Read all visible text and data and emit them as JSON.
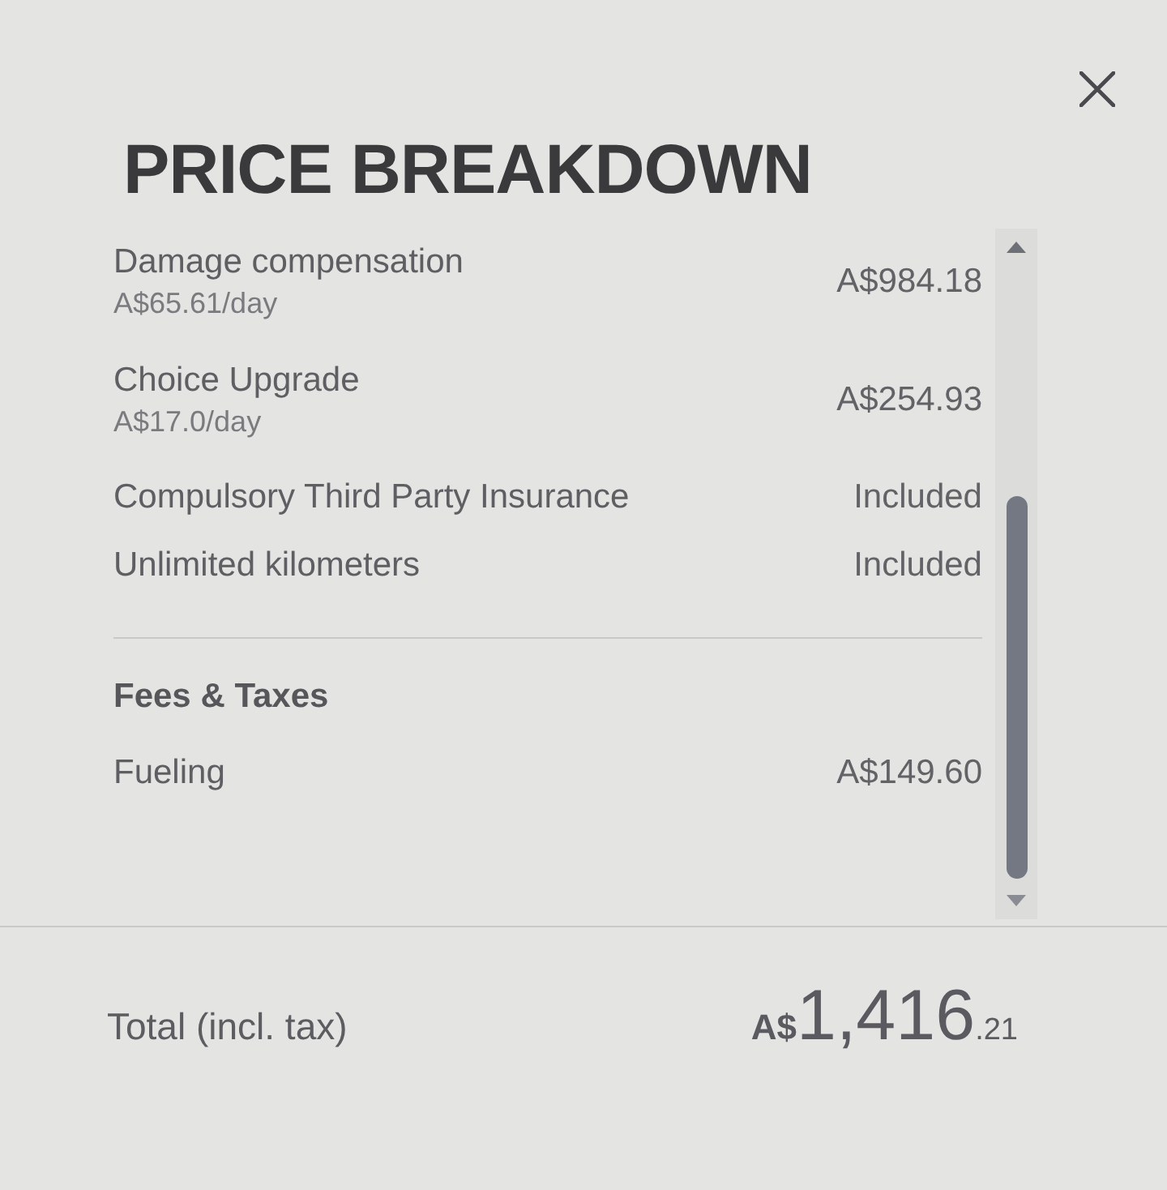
{
  "title": "PRICE BREAKDOWN",
  "sections": [
    {
      "items": [
        {
          "name": "Damage compensation",
          "rate": "A$65.61/day",
          "price": "A$984.18"
        },
        {
          "name": "Choice Upgrade",
          "rate": "A$17.0/day",
          "price": "A$254.93"
        },
        {
          "name": "Compulsory Third Party Insurance",
          "price": "Included"
        },
        {
          "name": "Unlimited kilometers",
          "price": "Included"
        }
      ]
    },
    {
      "heading": "Fees & Taxes",
      "items": [
        {
          "name": "Fueling",
          "price": "A$149.60"
        }
      ]
    }
  ],
  "total": {
    "label": "Total (incl. tax)",
    "currency": "A$",
    "whole": "1,416",
    "cents": ".21"
  }
}
